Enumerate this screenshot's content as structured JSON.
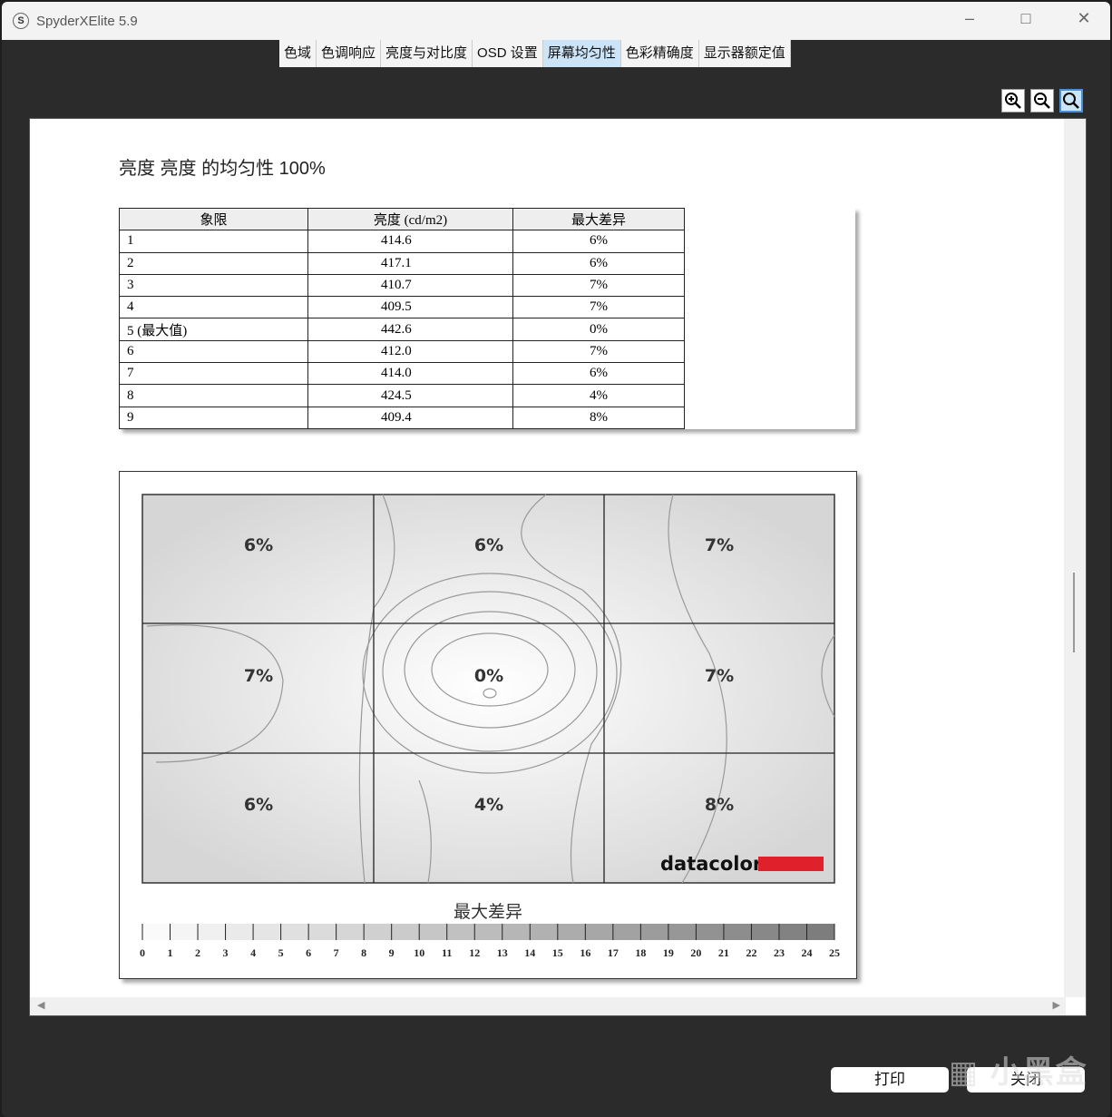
{
  "window": {
    "title": "SpyderXElite 5.9",
    "icon_letter": "S"
  },
  "tabs": [
    {
      "label": "色域"
    },
    {
      "label": "色调响应"
    },
    {
      "label": "亮度与对比度"
    },
    {
      "label": "OSD 设置"
    },
    {
      "label": "屏幕均匀性",
      "active": true
    },
    {
      "label": "色彩精确度"
    },
    {
      "label": "显示器额定值"
    }
  ],
  "report": {
    "heading": "亮度 亮度 的均匀性 100%",
    "table": {
      "headers": [
        "象限",
        "亮度 (cd/m2)",
        "最大差异"
      ],
      "rows": [
        [
          "1",
          "414.6",
          "6%"
        ],
        [
          "2",
          "417.1",
          "6%"
        ],
        [
          "3",
          "410.7",
          "7%"
        ],
        [
          "4",
          "409.5",
          "7%"
        ],
        [
          "5 (最大值)",
          "442.6",
          "0%"
        ],
        [
          "6",
          "412.0",
          "7%"
        ],
        [
          "7",
          "414.0",
          "6%"
        ],
        [
          "8",
          "424.5",
          "4%"
        ],
        [
          "9",
          "409.4",
          "8%"
        ]
      ]
    },
    "map": {
      "cells": [
        "6%",
        "6%",
        "7%",
        "7%",
        "0%",
        "7%",
        "6%",
        "4%",
        "8%"
      ],
      "logo": "datacolor",
      "logo_color": "#e0202a"
    },
    "legend": {
      "title": "最大差异",
      "ticks": [
        "0",
        "1",
        "2",
        "3",
        "4",
        "5",
        "6",
        "7",
        "8",
        "9",
        "10",
        "11",
        "12",
        "13",
        "14",
        "15",
        "16",
        "17",
        "18",
        "19",
        "20",
        "21",
        "22",
        "23",
        "24",
        "25"
      ]
    }
  },
  "buttons": {
    "print": "打印",
    "close": "关闭"
  },
  "watermark": "小黑盒"
}
